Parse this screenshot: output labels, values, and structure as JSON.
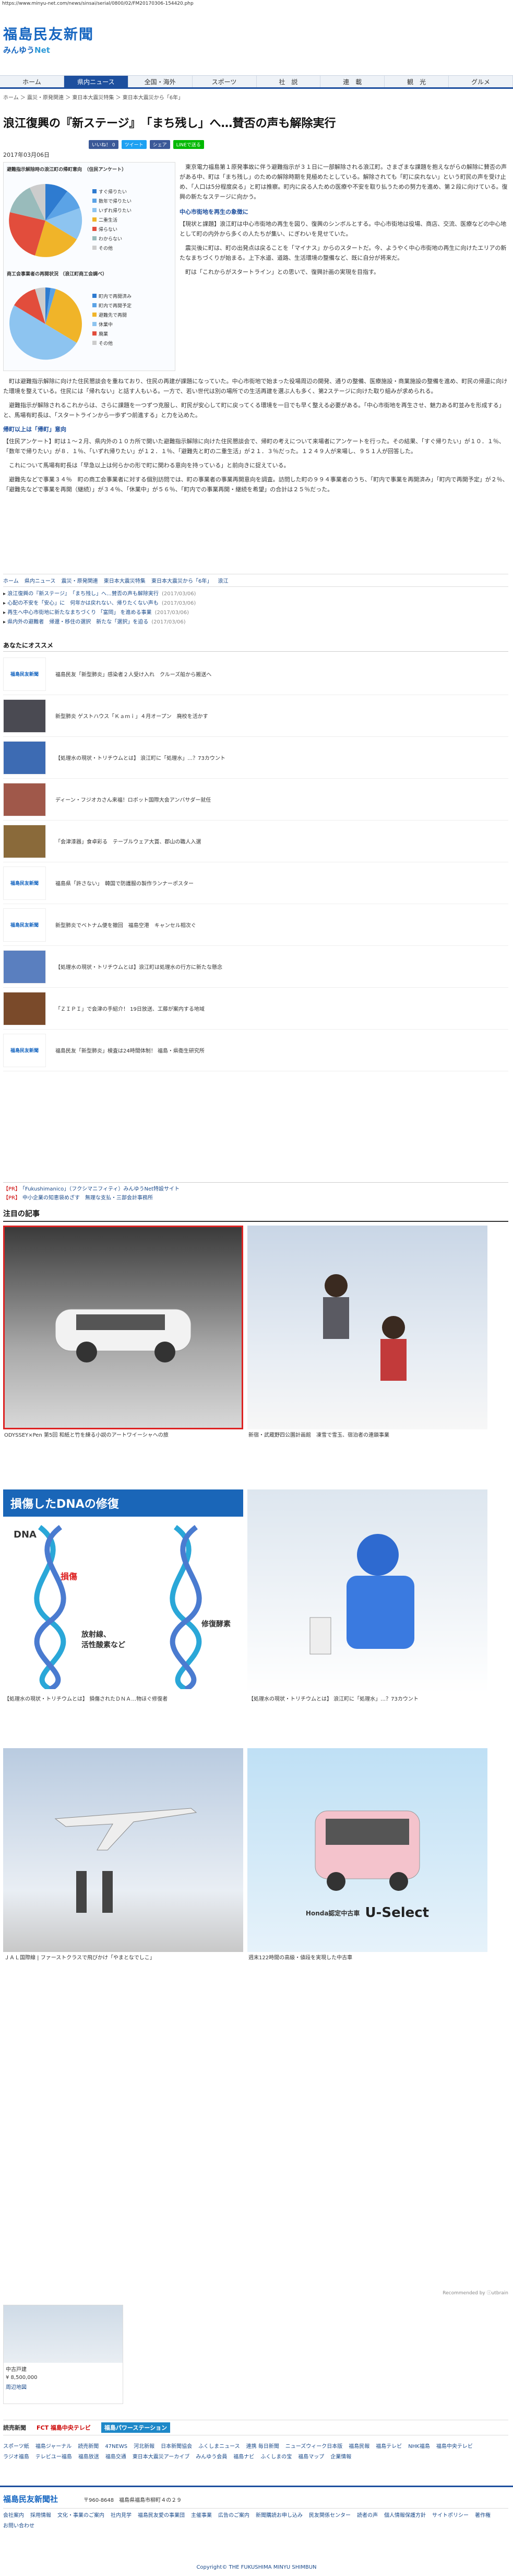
{
  "browser": {
    "url": "https://www.minyu-net.com/news/sinsai/serial/0800/02/FM20170306-154420.php"
  },
  "site": {
    "name": "福島民友新聞",
    "sub_prefix": "みんゆう",
    "sub_suffix": "Net"
  },
  "nav": [
    "ホーム",
    "県内ニュース",
    "全国・海外",
    "スポーツ",
    "社　説",
    "連　載",
    "観　光",
    "グルメ"
  ],
  "breadcrumb": "ホーム ＞ 震災・原発関連 ＞ 東日本大震災特集 ＞ 東日本大震災から「6年」",
  "article": {
    "title": "浪江復興の『新ステージ』　「まち残し」へ…賛否の声も解除実行",
    "share": [
      "いいね！ 0",
      "ツイート",
      "シェア",
      "LINEで送る"
    ],
    "date": "2017年03月06日",
    "intro": "　東京電力福島第１原発事故に伴う避難指示が３１日に一部解除される浪江町。さまざまな課題を抱えながらの解除に賛否の声がある中、町は「まち残し」のための解除時期を見極めたとしている。解除されても「町に戻れない」という町民の声を受け止め、「人口は5分程度戻る」と町は推察。町内に戻る人ための医療や不安を取り払うための努力を進め、第２段に向けている。復興の新たなステージに向かう。",
    "sub1": "中心市街地を再生の象徴に",
    "p1": "【現状と課題】浪江町は中心市街地の再生を図り、復興のシンボルとする。中心市街地は役場、商店、交流、医療などの中心地として町の内外から多くの人たちが集い、にぎわいを見せていた。",
    "p2": "　震災後に町は、町の出発点は戻ることを「マイナス」からのスタートだ。今、ようやく中心市街地の再生に向けたエリアの新たなまちづくりが始まる。上下水道、道路、生活環境の整備など、既に自分が将来だ。",
    "p3": "　町は「これからがスタートライン」との思いで、復興計画の実現を目指す。",
    "p4": "　町は避難指示解除に向けた住民懇談会を重ねており、住民の再建が課題になっていた。中心市街地で始まった役場周辺の開発、通りの整備、医療施設・商業施設の整備を進め、町民の帰還に向けた環境を整えている。住民には「帰れない」と話す人もいる。一方で、若い世代は別の場所での生活再建を選ぶ人も多く、第2ステージに向けた取り組みが求められる。",
    "p5": "　避難指示が解除されるこれからは、さらに課題を一つずつ克服し、町民が安心して町に戻ってくる環境を一日でも早く整える必要がある。「中心市街地を再生させ、魅力ある町並みを形成する」と、馬場有町長は、「スタートラインから一歩ずつ前進する」と力を込めた。",
    "sub2": "帰町以上は「帰町」意向",
    "p6": "【住民アンケート】町は１～２月、県内外の１０カ所で開いた避難指示解除に向けた住民懇談会で、帰町の考えについて来場者にアンケートを行った。その結果、「すぐ帰りたい」が１０．１％、「数年で帰りたい」が８．１％、「いずれ帰りたい」が１２．１％、「避難先と町の二重生活」が２１．３％だった。１２４９人が来場し、９５１人が回答した。",
    "p7": "　これについて馬場有町長は「早急以上は何らかの形で町に関わる意向を持っている」と前向きに捉えている。",
    "p8": "　避難先などで事業３４％　町の商工会事業者に対する個別訪問では、町の事業者の事業再開意向を調査。訪問した町の９９４事業者のうち、「町内で事業を再開済み」「町内で再開予定」が２％、「避難先などで事業を再開（継続）」が３４％、「休業中」が５６％、「町内での事業再開・継続を希望」の合計は２５％だった。",
    "tags": [
      "ホーム",
      "県内ニュース",
      "震災・原発関連",
      "東日本大震災特集",
      "東日本大震災から「6年」",
      "浪江"
    ],
    "related": [
      {
        "t": "浪江復興の『新ステージ』　「まち残し」へ…賛否の声も解除実行",
        "d": "(2017/03/06)"
      },
      {
        "t": "心配の不安を「安心」に　何年かは戻れない、帰りたくない声も",
        "d": "(2017/03/06)"
      },
      {
        "t": "再生へ中心市街地に新たなまちづくり 「富岡」 を進める事業",
        "d": "(2017/03/06)"
      },
      {
        "t": "県内外の避難者　帰還・移住の選択　新たな「選択」を迫る",
        "d": "(2017/03/06)"
      }
    ]
  },
  "charts": {
    "pie1_title": "避難指示解除時の浪江町の帰町意向　（住民アンケート）",
    "pie1_legend": [
      "すぐ帰りたい",
      "数年で帰りたい",
      "いずれ帰りたい",
      "二重生活",
      "帰らない",
      "わからない",
      "その他"
    ],
    "pie2_title": "商工会事業者の再開状況 （浪江町商工会調べ）",
    "pie2_legend": [
      "町内で再開済み",
      "町内で再開予定",
      "避難先で再開",
      "休業中",
      "廃業",
      "その他"
    ]
  },
  "recommend": {
    "title": "あなたにオススメ",
    "items": [
      "福島民友「新型肺炎」感染者２人受け入れ　クルーズ船から搬送へ",
      "新型肺炎 ゲストハウス「Ｋａｍｉ」４月オープン　廃校を活かす",
      "【処理水の現状・トリチウムとは】 浪江町に「処理水」…？73カウント",
      "ディーン・フジオカさん来福！ロボット国際大会アンバサダー就任",
      "「会津漆器」食卓彩る　テーブルウェア大賞、郡山の職人入選",
      "福島県「許さない」　韓国で防護服の製作ランナーポスター",
      "新型肺炎でベトナム便を撤回　福島空港　キャンセル相次ぐ",
      "【処理水の現状・トリチウムとは】浪江町は処理水の行方に新たな懸念",
      "「ＺＩＰＩ」で会津の手紹介！ 19日放送、工藤が案内する地域",
      "福島民友「新型肺炎」検査は24時間体制！ 福島・県衛生研究所"
    ]
  },
  "promo": {
    "pr1": "【PR】",
    "a1": "「Fukushimanico」（フクシマニフィティ）みんゆうNet特設サイト",
    "pr2": "【PR】",
    "a2": "中小企業の知恵袋めざす　無理な支払・三部会計事務所"
  },
  "attention": {
    "title": "注目の記事",
    "cells": [
      "ODYSSEY×Pen 第5回 和紙と竹を練る小説のアートワイーシャへの旅",
      "新宿・武蔵野四公園計画館　凍雪で雪玉、宿泊者の連鎖事業",
      "【処理水の現状・トリチウムとは】 損傷されたＤＮＡ…物ほぐ修復者",
      "【処理水の現状・トリチウムとは】 浪江町に「処理水」…？73カウント",
      "ＪＡＬ国際線 | ファーストクラスで飛びかけ「やまとなでしこ」",
      "週末122時間の高級・値段を実現した中古車"
    ],
    "dna": {
      "h": "損傷したDNAの修復",
      "lbl": "DNA",
      "dmg": "損傷",
      "r1": "放射線、",
      "r2": "活性酸素など",
      "rep": "修復酵素"
    },
    "car": {
      "h1": "Honda認定中古車",
      "h2": "U-Select"
    }
  },
  "recommended_by": "Recommended by ⓘutbrain",
  "sidead": {
    "title": "中古戸建",
    "price": "¥ 8,500,000",
    "map": "周辺地図"
  },
  "partners": [
    "読売新聞",
    "FCT 福島中央テレビ",
    "福島パワーステーション"
  ],
  "links": [
    "スポーツ紙",
    "福島ジャーナル",
    "読売新聞",
    "47NEWS",
    "河北新報",
    "日本新聞協会",
    "ふくしまニュース",
    "連携 毎日新聞",
    "ニューズウィーク日本版",
    "福島民報",
    "福島テレビ",
    "NHK福島",
    "福島中央テレビ",
    "ラジオ福島",
    "テレビユー福島",
    "福島放送",
    "福島交通",
    "東日本大震災アーカイブ",
    "みんゆう会員",
    "福島ナビ",
    "ふくしまの宝",
    "福島マップ",
    "企業情報"
  ],
  "footer": {
    "logo": "福島民友新聞社",
    "addr": "〒960-8648　福島県福島市柳町４の２９",
    "nav": [
      "会社案内",
      "採用情報",
      "文化・事業のご案内",
      "社内見学",
      "福島民友愛の事業団",
      "主催事業",
      "広告のご案内",
      "新聞購読お申し込み",
      "民友関係センター",
      "読者の声",
      "個人情報保護方針",
      "サイトポリシー",
      "著作権",
      "お問い合わせ"
    ],
    "copy": "Copyright© THE FUKUSHIMA MINYU SHIMBUN"
  }
}
